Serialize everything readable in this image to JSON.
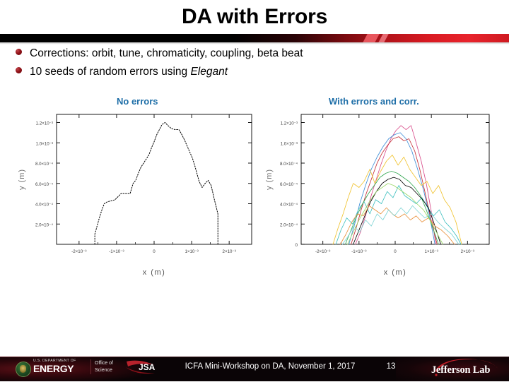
{
  "slide": {
    "title": "DA with Errors",
    "page_number": "13"
  },
  "bullets": [
    {
      "text_before": "Corrections: orbit, tune, chromaticity, coupling, beta beat",
      "italic": "",
      "text_after": ""
    },
    {
      "text_before": "10 seeds of random errors using ",
      "italic": "Elegant",
      "text_after": ""
    }
  ],
  "captions": {
    "left": "No errors",
    "right": "With errors and corr.",
    "color": "#1F6FA8"
  },
  "footer": {
    "doe_small": "U.S. DEPARTMENT OF",
    "doe_big": "ENERGY",
    "science_line1": "Office of",
    "science_line2": "Science",
    "jsa_label": "JSA",
    "conference": "ICFA Mini-Workshop on DA, November 1, 2017",
    "lab": "Jefferson Lab"
  },
  "chart_data": [
    {
      "id": "no-errors",
      "type": "line",
      "title": "No errors",
      "xlabel": "x (m)",
      "ylabel": "y (m)",
      "xlim": [
        -0.0026,
        0.0026
      ],
      "ylim": [
        0,
        0.00128
      ],
      "xticks": [
        -0.002,
        -0.001,
        0,
        0.001,
        0.002
      ],
      "xticklabels": [
        "-2×10⁻³",
        "-1×10⁻³",
        "0",
        "1×10⁻³",
        "2×10⁻³"
      ],
      "yticks": [
        0.0002,
        0.0004,
        0.0006,
        0.0008,
        0.001,
        0.0012
      ],
      "yticklabels": [
        "2.0×10⁻⁴",
        "4.0×10⁻⁴",
        "6.0×10⁻⁴",
        "8.0×10⁻⁴",
        "1.0×10⁻³",
        "1.2×10⁻³"
      ],
      "grid": false,
      "legend": "none",
      "series": [
        {
          "name": "dynamic aperture boundary",
          "color": "#000000",
          "style": "dashed",
          "x": [
            -0.00158,
            -0.00158,
            -0.00152,
            -0.00146,
            -0.0014,
            -0.00133,
            -0.00124,
            -0.00112,
            -0.00104,
            -0.00096,
            -0.00088,
            -0.0008,
            -0.00072,
            -0.00064,
            -0.00056,
            -0.00049,
            -0.00042,
            -0.00035,
            -0.00028,
            -0.00021,
            -0.00014,
            -7e-05,
            0.0,
            7e-05,
            0.00014,
            0.00021,
            0.00029,
            0.00037,
            0.00046,
            0.00056,
            0.00066,
            0.00074,
            0.00082,
            0.00089,
            0.00096,
            0.00102,
            0.00108,
            0.00114,
            0.0012,
            0.00128,
            0.00136,
            0.00144,
            0.00152,
            0.0016,
            0.00166,
            0.0017,
            0.0017
          ],
          "y": [
            0.0,
            0.0001,
            0.00018,
            0.00026,
            0.00033,
            0.0004,
            0.00042,
            0.00043,
            0.00044,
            0.00047,
            0.0005,
            0.0005,
            0.0005,
            0.0005,
            0.0006,
            0.00063,
            0.0007,
            0.00076,
            0.0008,
            0.00084,
            0.00088,
            0.00095,
            0.00101,
            0.00108,
            0.00113,
            0.00118,
            0.0012,
            0.00117,
            0.00114,
            0.00113,
            0.00113,
            0.00108,
            0.00102,
            0.00096,
            0.0009,
            0.00085,
            0.00078,
            0.0007,
            0.00062,
            0.00056,
            0.0006,
            0.00063,
            0.00058,
            0.00045,
            0.00036,
            0.0003,
            0.0
          ]
        }
      ]
    },
    {
      "id": "with-errors-and-corr",
      "type": "line",
      "title": "With errors and corr.",
      "xlabel": "x (m)",
      "ylabel": "y (m)",
      "xlim": [
        -0.0026,
        0.0026
      ],
      "ylim": [
        0,
        0.00128
      ],
      "xticks": [
        -0.002,
        -0.001,
        0,
        0.001,
        0.002
      ],
      "xticklabels": [
        "-2×10⁻³",
        "-1×10⁻³",
        "0",
        "1×10⁻³",
        "2×10⁻³"
      ],
      "yticks": [
        0,
        0.0002,
        0.0004,
        0.0006,
        0.0008,
        0.001,
        0.0012
      ],
      "yticklabels": [
        "0",
        "2.0×10⁻⁴",
        "4.0×10⁻⁴",
        "6.0×10⁻⁴",
        "8.0×10⁻⁴",
        "1.0×10⁻³",
        "1.2×10⁻³"
      ],
      "grid": false,
      "legend": "none",
      "seed_count": 10,
      "series": [
        {
          "name": "seed 1",
          "color": "#D94F8C",
          "x": [
            -0.0011,
            -0.00096,
            -0.00082,
            -0.00068,
            -0.00054,
            -0.0004,
            -0.00026,
            -0.00012,
            2e-05,
            0.00016,
            0.0003,
            0.00044,
            0.00058,
            0.00072,
            0.00086,
            0.001,
            0.00112
          ],
          "y": [
            0.0,
            0.00012,
            0.00028,
            0.00046,
            0.00062,
            0.00078,
            0.00092,
            0.00104,
            0.00112,
            0.00117,
            0.00113,
            0.00117,
            0.001,
            0.00082,
            0.0006,
            0.00032,
            0.0
          ]
        },
        {
          "name": "seed 2",
          "color": "#C6333A",
          "x": [
            -0.00122,
            -0.00108,
            -0.00094,
            -0.0008,
            -0.00064,
            -0.0005,
            -0.00036,
            -0.0002,
            -6e-05,
            0.0001,
            0.00024,
            0.00038,
            0.00054,
            0.00068,
            0.00082,
            0.00098,
            0.00116
          ],
          "y": [
            0.0,
            0.00016,
            0.00034,
            0.0005,
            0.00066,
            0.0008,
            0.0009,
            0.00098,
            0.00104,
            0.00106,
            0.00102,
            0.00104,
            0.00092,
            0.00074,
            0.00052,
            0.00026,
            0.0
          ]
        },
        {
          "name": "seed 3",
          "color": "#3F8FD8",
          "x": [
            -0.00128,
            -0.00112,
            -0.00098,
            -0.00082,
            -0.00066,
            -0.0005,
            -0.00034,
            -0.00018,
            -2e-05,
            0.00014,
            0.0003,
            0.00046,
            0.00062,
            0.00078,
            0.00094,
            0.0011
          ],
          "y": [
            0.0,
            0.0002,
            0.0004,
            0.00058,
            0.00074,
            0.00086,
            0.00096,
            0.00104,
            0.00108,
            0.0011,
            0.00104,
            0.00092,
            0.00074,
            0.00054,
            0.0003,
            0.0
          ]
        },
        {
          "name": "seed 4",
          "color": "#F0C330",
          "x": [
            -0.00172,
            -0.00158,
            -0.00144,
            -0.0013,
            -0.00116,
            -0.001,
            -0.00086,
            -0.0007,
            -0.00056,
            -0.0004,
            -0.00024,
            -8e-05,
            8e-05,
            0.00024,
            0.0004,
            0.00056,
            0.00072,
            0.00088,
            0.00104,
            0.0012,
            0.00136,
            0.00152,
            0.00168,
            0.00184
          ],
          "y": [
            0.0,
            0.00016,
            0.0003,
            0.00046,
            0.0006,
            0.00056,
            0.00062,
            0.00074,
            0.0006,
            0.00072,
            0.00082,
            0.00088,
            0.00078,
            0.00086,
            0.00074,
            0.00066,
            0.00058,
            0.00062,
            0.0005,
            0.00058,
            0.00044,
            0.00036,
            0.00022,
            0.0
          ]
        },
        {
          "name": "seed 5",
          "color": "#3DBFBF",
          "x": [
            -0.00164,
            -0.0015,
            -0.00134,
            -0.00118,
            -0.00102,
            -0.00086,
            -0.0007,
            -0.00054,
            -0.00038,
            -0.00022,
            -6e-05,
            0.0001,
            0.00026,
            0.00042,
            0.00058,
            0.00074,
            0.0009,
            0.00106,
            0.00122,
            0.00138,
            0.00154,
            0.0017,
            0.00182
          ],
          "y": [
            0.0,
            0.00014,
            0.00026,
            0.0002,
            0.00034,
            0.00042,
            0.0003,
            0.00044,
            0.0004,
            0.00052,
            0.00046,
            0.00058,
            0.00048,
            0.00044,
            0.0004,
            0.00046,
            0.00036,
            0.00028,
            0.00034,
            0.00022,
            0.00016,
            8e-05,
            0.0
          ]
        },
        {
          "name": "seed 6",
          "color": "#35A853",
          "x": [
            -0.00138,
            -0.00122,
            -0.00106,
            -0.0009,
            -0.00074,
            -0.00058,
            -0.00042,
            -0.00026,
            -0.0001,
            6e-05,
            0.00022,
            0.00038,
            0.00054,
            0.0007,
            0.00086,
            0.00102,
            0.0012
          ],
          "y": [
            0.0,
            0.00014,
            0.00028,
            0.0004,
            0.0005,
            0.00058,
            0.00066,
            0.0007,
            0.00072,
            0.0007,
            0.00066,
            0.00062,
            0.00056,
            0.00048,
            0.00034,
            0.00018,
            0.0
          ]
        },
        {
          "name": "seed 7",
          "color": "#000000",
          "x": [
            -0.00116,
            -0.001,
            -0.00084,
            -0.00068,
            -0.00052,
            -0.00036,
            -0.0002,
            -4e-05,
            0.00012,
            0.00028,
            0.00044,
            0.0006,
            0.00076,
            0.00092,
            0.00108,
            0.00126
          ],
          "y": [
            0.0,
            0.00014,
            0.00028,
            0.00042,
            0.00052,
            0.0006,
            0.00064,
            0.00066,
            0.00064,
            0.00058,
            0.00056,
            0.0005,
            0.00044,
            0.00036,
            0.0002,
            0.0
          ]
        },
        {
          "name": "seed 8",
          "color": "#E8913C",
          "x": [
            -0.00152,
            -0.00136,
            -0.0012,
            -0.00104,
            -0.00088,
            -0.00072,
            -0.00056,
            -0.0004,
            -0.00024,
            -8e-05,
            8e-05,
            0.00026,
            0.00042,
            0.00058,
            0.00074,
            0.00092,
            0.0011,
            0.00128,
            0.00146,
            0.00164
          ],
          "y": [
            0.0,
            0.0001,
            0.00022,
            0.0003,
            0.00028,
            0.00038,
            0.00034,
            0.0003,
            0.00036,
            0.0003,
            0.00026,
            0.0003,
            0.00024,
            0.00028,
            0.00022,
            0.00026,
            0.00018,
            0.00014,
            8e-05,
            0.0
          ]
        },
        {
          "name": "seed 9",
          "color": "#7FD4D4",
          "x": [
            -0.00146,
            -0.0013,
            -0.00114,
            -0.00098,
            -0.00082,
            -0.00066,
            -0.0005,
            -0.00034,
            -0.00018,
            -2e-05,
            0.00016,
            0.00032,
            0.00048,
            0.00064,
            0.00082,
            0.001,
            0.00118,
            0.00136,
            0.00156,
            0.00176
          ],
          "y": [
            0.0,
            8e-05,
            0.00018,
            0.00012,
            0.00024,
            0.00018,
            0.0003,
            0.00024,
            0.00034,
            0.00028,
            0.00036,
            0.0003,
            0.00038,
            0.00032,
            0.00026,
            0.0003,
            0.00022,
            0.00016,
            0.0001,
            0.0
          ]
        },
        {
          "name": "seed 10",
          "color": "#9CD86A",
          "x": [
            -0.00132,
            -0.00116,
            -0.001,
            -0.00084,
            -0.00068,
            -0.00052,
            -0.00036,
            -0.0002,
            -4e-05,
            0.00012,
            0.00028,
            0.00044,
            0.0006,
            0.00078,
            0.00096,
            0.00114,
            0.00132
          ],
          "y": [
            0.0,
            0.00012,
            0.00024,
            0.00034,
            0.00044,
            0.00052,
            0.00056,
            0.0006,
            0.00058,
            0.00054,
            0.0005,
            0.00046,
            0.0004,
            0.00034,
            0.00024,
            0.00012,
            0.0
          ]
        }
      ]
    }
  ]
}
